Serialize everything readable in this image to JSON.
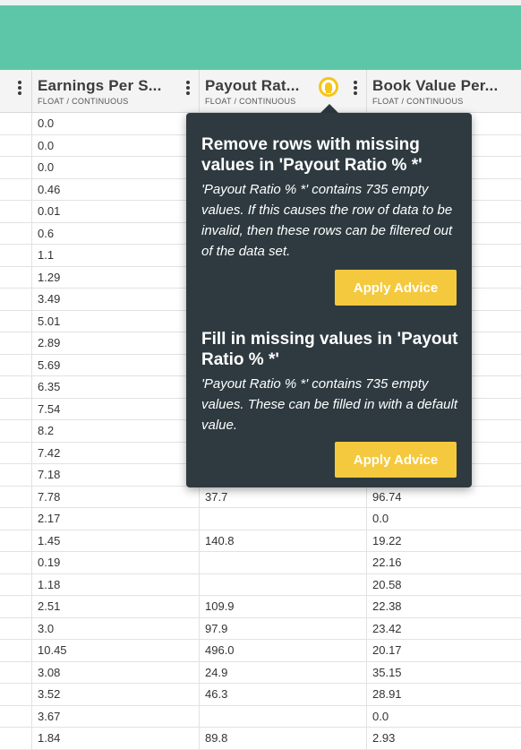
{
  "columns": [
    {
      "title": "Earnings Per S...",
      "type": "FLOAT / CONTINUOUS"
    },
    {
      "title": "Payout Rat...",
      "type": "FLOAT / CONTINUOUS"
    },
    {
      "title": "Book Value Per...",
      "type": "FLOAT / CONTINUOUS"
    }
  ],
  "rows": [
    [
      "0.0",
      "",
      ""
    ],
    [
      "0.0",
      "",
      ""
    ],
    [
      "0.0",
      "",
      ""
    ],
    [
      "0.46",
      "",
      ""
    ],
    [
      "0.01",
      "",
      ""
    ],
    [
      "0.6",
      "",
      ""
    ],
    [
      "1.1",
      "",
      ""
    ],
    [
      "1.29",
      "",
      ""
    ],
    [
      "3.49",
      "",
      ""
    ],
    [
      "5.01",
      "",
      ""
    ],
    [
      "2.89",
      "",
      ""
    ],
    [
      "5.69",
      "",
      ""
    ],
    [
      "6.35",
      "",
      ""
    ],
    [
      "7.54",
      "",
      ""
    ],
    [
      "8.2",
      "",
      ""
    ],
    [
      "7.42",
      "",
      ""
    ],
    [
      "7.18",
      "",
      ""
    ],
    [
      "7.78",
      "37.7",
      "96.74"
    ],
    [
      "2.17",
      "",
      "0.0"
    ],
    [
      "1.45",
      "140.8",
      "19.22"
    ],
    [
      "0.19",
      "",
      "22.16"
    ],
    [
      "1.18",
      "",
      "20.58"
    ],
    [
      "2.51",
      "109.9",
      "22.38"
    ],
    [
      "3.0",
      "97.9",
      "23.42"
    ],
    [
      "10.45",
      "496.0",
      "20.17"
    ],
    [
      "3.08",
      "24.9",
      "35.15"
    ],
    [
      "3.52",
      "46.3",
      "28.91"
    ],
    [
      "3.67",
      "",
      "0.0"
    ],
    [
      "1.84",
      "89.8",
      "2.93"
    ]
  ],
  "advice": {
    "icon": "lightbulb-icon",
    "items": [
      {
        "title": "Remove rows with missing values in 'Payout Ratio % *'",
        "description": "'Payout Ratio % *' contains 735 empty values. If this causes the row of data to be invalid, then these rows can be filtered out of the data set.",
        "button_label": "Apply Advice"
      },
      {
        "title": "Fill in missing values in 'Payout Ratio % *'",
        "description": "'Payout Ratio % *' contains 735 empty values. These can be filled in with a default value.",
        "button_label": "Apply Advice"
      }
    ]
  },
  "colors": {
    "topbar": "#5ec6a8",
    "popover": "#2e3a40",
    "accent_button": "#f5c93d"
  }
}
